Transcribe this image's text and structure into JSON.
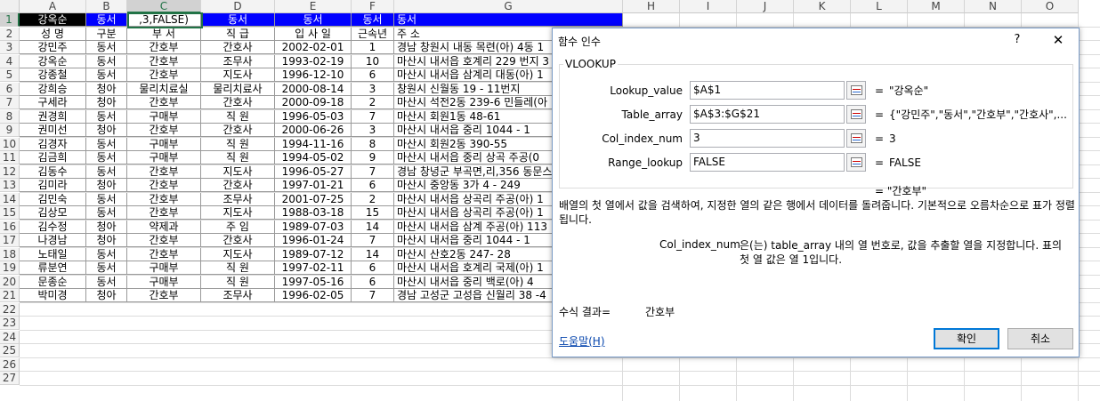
{
  "sheet": {
    "columns": [
      "A",
      "B",
      "C",
      "D",
      "E",
      "F",
      "G",
      "H",
      "I",
      "J",
      "K",
      "L",
      "M",
      "N",
      "O"
    ],
    "row_numbers": [
      "1",
      "2",
      "3",
      "4",
      "5",
      "6",
      "7",
      "8",
      "9",
      "10",
      "11",
      "12",
      "13",
      "14",
      "15",
      "16",
      "17",
      "18",
      "19",
      "20",
      "21",
      "22",
      "23",
      "24",
      "25",
      "26",
      "27"
    ],
    "row1": [
      "강옥순",
      "동서",
      ",3,FALSE)",
      "동서",
      "동서",
      "동서",
      "동서"
    ],
    "headers": [
      "성  명",
      "구분",
      "부  서",
      "직  급",
      "입 사 일",
      "근속년",
      "주        소"
    ],
    "rows": [
      [
        "강민주",
        "동서",
        "간호부",
        "간호사",
        "2002-02-01",
        "1",
        "경남 창원시 내동 목련(아) 4동 1"
      ],
      [
        "강옥순",
        "동서",
        "간호부",
        "조무사",
        "1993-02-19",
        "10",
        "마산시 내서읍 호계리 229 번지 3"
      ],
      [
        "강종철",
        "동서",
        "간호부",
        "지도사",
        "1996-12-10",
        "6",
        "마산시 내서읍 삼계리 대동(아) 1"
      ],
      [
        "강희승",
        "청아",
        "물리치료실",
        "물리치료사",
        "2000-08-14",
        "3",
        "창원시 신월동 19 - 11번지"
      ],
      [
        "구세라",
        "청아",
        "간호부",
        "간호사",
        "2000-09-18",
        "2",
        "마산시 석전2동 239-6 민들레(아"
      ],
      [
        "권경희",
        "동서",
        "구매부",
        "직  원",
        "1996-05-03",
        "7",
        "마산시 회원1동 48-61"
      ],
      [
        "권미선",
        "청아",
        "간호부",
        "간호사",
        "2000-06-26",
        "3",
        "마산시 내서읍 중리 1044 - 1"
      ],
      [
        "김경자",
        "동서",
        "구매부",
        "직  원",
        "1994-11-16",
        "8",
        "마산시 회원2동 390-55"
      ],
      [
        "김금희",
        "동서",
        "구매부",
        "직  원",
        "1994-05-02",
        "9",
        "마산시 내서읍 중리 상곡 주공(0"
      ],
      [
        "김동수",
        "동서",
        "간호부",
        "지도사",
        "1996-05-27",
        "7",
        "경남 창녕군 부곡면,리,356 동문스"
      ],
      [
        "김미라",
        "청아",
        "간호부",
        "간호사",
        "1997-01-21",
        "6",
        "마산시 중앙동 3가 4 - 249"
      ],
      [
        "김민숙",
        "동서",
        "간호부",
        "조무사",
        "2001-07-25",
        "2",
        "마산시 내서읍 상곡리 주공(아) 1"
      ],
      [
        "김상모",
        "동서",
        "간호부",
        "지도사",
        "1988-03-18",
        "15",
        "마산시 내서읍 상곡리 주공(아) 1"
      ],
      [
        "김수정",
        "청아",
        "약제과",
        "주  임",
        "1989-07-03",
        "14",
        "마산시 내서읍 삼계 주공(아) 113"
      ],
      [
        "나경남",
        "청아",
        "간호부",
        "간호사",
        "1996-01-24",
        "7",
        "마산시 내서읍 중리 1044 - 1"
      ],
      [
        "노태일",
        "동서",
        "간호부",
        "지도사",
        "1989-07-12",
        "14",
        "마산시 산호2동 247- 28"
      ],
      [
        "류분연",
        "동서",
        "구매부",
        "직  원",
        "1997-02-11",
        "6",
        "마산시 내서읍 호계리 국제(아) 1"
      ],
      [
        "문종순",
        "동서",
        "구매부",
        "직  원",
        "1997-05-16",
        "6",
        "마산시 내서읍 중리 백로(아)  4"
      ],
      [
        "박미경",
        "청아",
        "간호부",
        "조무사",
        "1996-02-05",
        "7",
        "경남 고성군 고성읍 신월리 38 -4"
      ]
    ]
  },
  "dialog": {
    "title": "함수 인수",
    "help_glyph": "?",
    "close_glyph": "✕",
    "function_name": "VLOOKUP",
    "args": [
      {
        "label": "Lookup_value",
        "input": "$A$1",
        "result": "\"강옥순\""
      },
      {
        "label": "Table_array",
        "input": "$A$3:$G$21",
        "result": "{\"강민주\",\"동서\",\"간호부\",\"간호사\",..."
      },
      {
        "label": "Col_index_num",
        "input": "3",
        "result": "3"
      },
      {
        "label": "Range_lookup",
        "input": "FALSE",
        "result": "FALSE"
      }
    ],
    "eq": "=",
    "overall_result": "= \"간호부\"",
    "description": "배열의 첫 열에서 값을 검색하여, 지정한 열의 같은 행에서 데이터를 돌려줍니다. 기본적으로 오름차순으로 표가 정렬됩니다.",
    "arg_desc_name": "Col_index_num",
    "arg_desc_text": "은(는) table_array 내의 열 번호로, 값을 추출할 열을 지정합니다. 표의 첫 열 값은 열 1입니다.",
    "formula_result_label": "수식 결과=",
    "formula_result_value": "간호부",
    "help_link": "도움말(H)",
    "ok_label": "확인",
    "cancel_label": "취소"
  }
}
